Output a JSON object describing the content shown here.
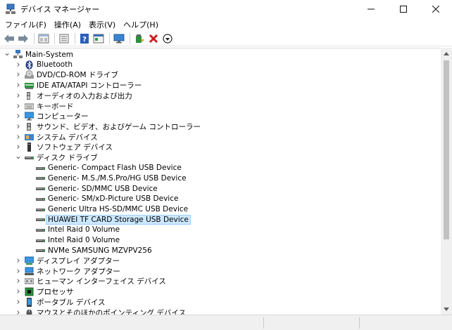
{
  "window": {
    "title": "デバイス マネージャー",
    "controls": {
      "minimize": "—",
      "maximize": "☐",
      "close": "✕"
    }
  },
  "menu": [
    "ファイル(F)",
    "操作(A)",
    "表示(V)",
    "ヘルプ(H)"
  ],
  "toolbar": [
    "back-arrow-icon",
    "forward-arrow-icon",
    "properties-icon",
    "list-icon",
    "help-icon",
    "details-icon",
    "monitor-icon",
    "update-driver-icon",
    "uninstall-icon",
    "download-icon"
  ],
  "tree": {
    "root": "Main-System",
    "categories": [
      {
        "label": "Bluetooth",
        "icon": "bluetooth-icon",
        "expanded": false
      },
      {
        "label": "DVD/CD-ROM ドライブ",
        "icon": "dvd-drive-icon",
        "expanded": false
      },
      {
        "label": "IDE ATA/ATAPI コントローラー",
        "icon": "ide-controller-icon",
        "expanded": false
      },
      {
        "label": "オーディオの入力および出力",
        "icon": "audio-io-icon",
        "expanded": false
      },
      {
        "label": "キーボード",
        "icon": "keyboard-icon",
        "expanded": false
      },
      {
        "label": "コンピューター",
        "icon": "computer-icon",
        "expanded": false
      },
      {
        "label": "サウンド、ビデオ、およびゲーム コントローラー",
        "icon": "sound-icon",
        "expanded": false
      },
      {
        "label": "システム デバイス",
        "icon": "system-devices-icon",
        "expanded": false
      },
      {
        "label": "ソフトウェア デバイス",
        "icon": "software-device-icon",
        "expanded": false
      },
      {
        "label": "ディスク ドライブ",
        "icon": "disk-drive-icon",
        "expanded": true,
        "children": [
          "Generic- Compact Flash USB Device",
          "Generic- M.S./M.S.Pro/HG USB Device",
          "Generic- SD/MMC USB Device",
          "Generic- SM/xD-Picture USB Device",
          "Generic Ultra HS-SD/MMC USB Device",
          "HUAWEI TF CARD Storage USB Device",
          "Intel Raid 0 Volume",
          "Intel Raid 0 Volume",
          "NVMe SAMSUNG MZVPV256"
        ],
        "selected_child": 5
      },
      {
        "label": "ディスプレイ アダプター",
        "icon": "display-adapter-icon",
        "expanded": false
      },
      {
        "label": "ネットワーク アダプター",
        "icon": "network-adapter-icon",
        "expanded": false
      },
      {
        "label": "ヒューマン インターフェイス デバイス",
        "icon": "hid-icon",
        "expanded": false
      },
      {
        "label": "プロセッサ",
        "icon": "processor-icon",
        "expanded": false
      },
      {
        "label": "ポータブル デバイス",
        "icon": "portable-device-icon",
        "expanded": false
      },
      {
        "label": "マウスとそのほかのポインティング デバイス",
        "icon": "mouse-icon",
        "expanded": false
      }
    ]
  },
  "colors": {
    "selection": "#cce8ff",
    "selection_border": "#99d1ff",
    "close_red": "#d41a1a"
  }
}
